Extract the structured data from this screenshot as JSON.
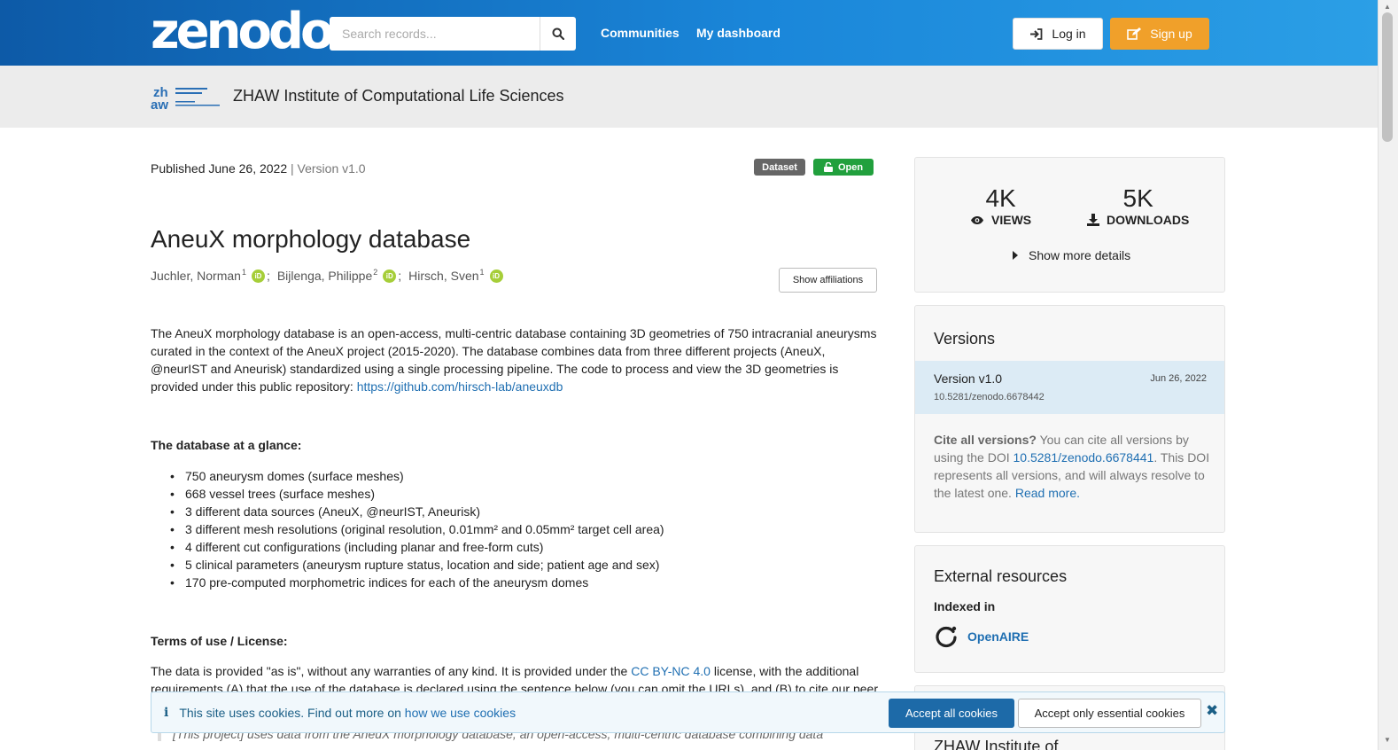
{
  "header": {
    "logo": "zenodo",
    "search_placeholder": "Search records...",
    "nav": [
      "Communities",
      "My dashboard"
    ],
    "login_label": "Log in",
    "signup_label": "Sign up"
  },
  "community": {
    "logo_text": "zh aw",
    "title": "ZHAW Institute of Computational Life Sciences"
  },
  "record": {
    "published": "Published June 26, 2022",
    "version": "| Version v1.0",
    "badges": [
      "Dataset",
      "Open"
    ],
    "title": "AneuX morphology database",
    "authors": [
      {
        "name": "Juchler, Norman",
        "aff": "1"
      },
      {
        "name": "Bijlenga, Philippe",
        "aff": "2"
      },
      {
        "name": "Hirsch, Sven",
        "aff": "1"
      }
    ],
    "show_affiliations": "Show affiliations",
    "description": "The AneuX morphology database is an open-access, multi-centric database containing 3D geometries of 750 intracranial aneurysms curated in the context of the AneuX project (2015-2020). The database combines data from three different projects (AneuX, @neurIST and Aneurisk) standardized using a single processing pipeline. The code to process and view the 3D geometries is provided under this public repository: ",
    "repo_link": "https://github.com/hirsch-lab/aneuxdb",
    "glance_heading": "The database at a glance:",
    "glance_items": [
      "750 aneurysm domes (surface meshes)",
      "668 vessel trees (surface meshes)",
      "3 different data sources (AneuX, @neurIST, Aneurisk)",
      "3 different mesh resolutions (original resolution, 0.01mm² and 0.05mm² target cell area)",
      "4 different cut configurations (including planar and free-form cuts)",
      "5 clinical parameters (aneurysm rupture status, location and side; patient age and sex)",
      "170 pre-computed morphometric indices for each of the aneurysm domes"
    ],
    "terms_heading": "Terms of use / License:",
    "terms_text_1": "The data is provided \"as is\", without any warranties of any kind. It is provided under the ",
    "license_link": "CC BY-NC 4.0",
    "terms_text_2": " license, with the additional requirements (A) that the use of the database is declared using the sentence below (you can omit the URLs), and (B) to cite our peer",
    "quote": "[This project] uses data from the AneuX morphology database, an open-access, multi-centric database combining data"
  },
  "sidebar": {
    "views": "4K",
    "views_label": "VIEWS",
    "downloads": "5K",
    "downloads_label": "DOWNLOADS",
    "more_details": "Show more details",
    "versions_heading": "Versions",
    "version_name": "Version v1.0",
    "version_date": "Jun 26, 2022",
    "version_doi": "10.5281/zenodo.6678442",
    "cite_all_bold": "Cite all versions?",
    "cite_all_text_1": " You can cite all versions by using the DOI ",
    "cite_all_doi": "10.5281/zenodo.6678441",
    "cite_all_text_2": ". This DOI represents all versions, and will always resolve to the latest one. ",
    "read_more": "Read more.",
    "external_heading": "External resources",
    "indexed_in": "Indexed in",
    "openaire": "OpenAIRE",
    "next_panel_heading": "ZHAW Institute of..."
  },
  "cookie": {
    "text": "This site uses cookies. Find out more on ",
    "link": "how we use cookies",
    "accept_all": "Accept all cookies",
    "accept_essential": "Accept only essential cookies"
  }
}
